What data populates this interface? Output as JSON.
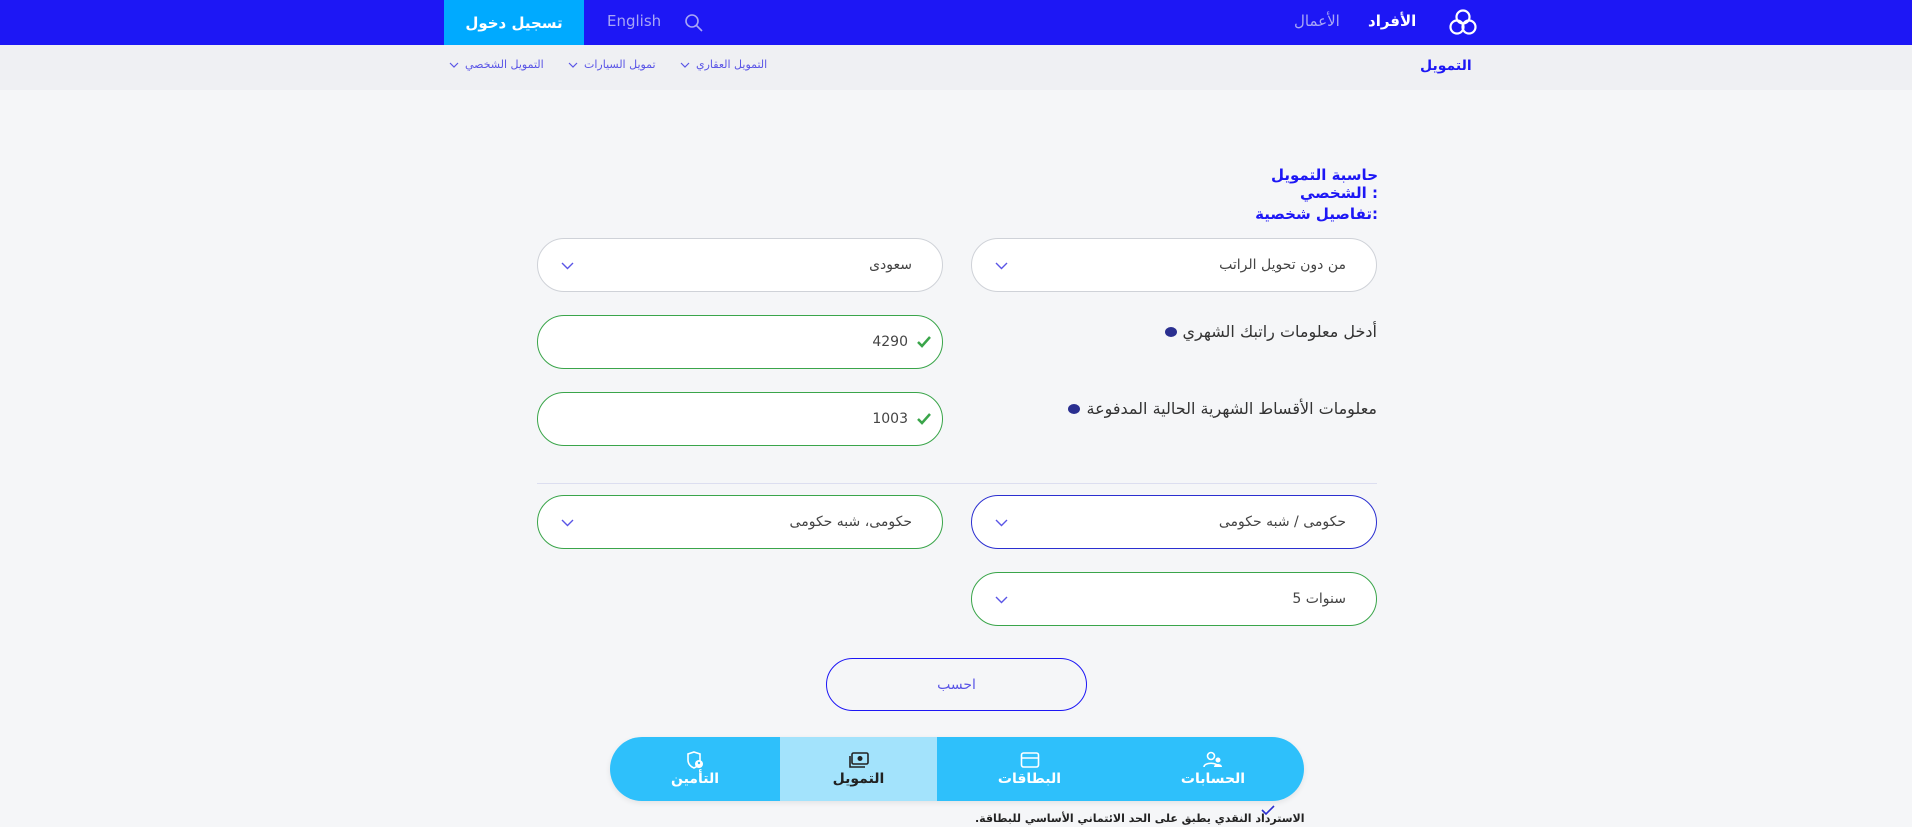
{
  "header": {
    "nav_individuals": "الأفراد",
    "nav_business": "الأعمال",
    "language": "English",
    "login": "تسجيل دخول"
  },
  "subnav": {
    "title": "التمويل",
    "items": [
      {
        "label": "التمويل العقاري"
      },
      {
        "label": "تمويل السيارات"
      },
      {
        "label": "التمويل الشخصي"
      }
    ]
  },
  "form": {
    "heading": "حاسبة التمويل الشخصي :",
    "subheading": "تفاصيل شخصية:",
    "salary_transfer": {
      "value": "من دون تحويل الراتب"
    },
    "nationality": {
      "value": "سعودى"
    },
    "salary": {
      "label": "أدخل معلومات راتبك الشهري",
      "value": "4290"
    },
    "installments": {
      "label": "معلومات الأقساط الشهرية الحالية المدفوعة",
      "value": "1003"
    },
    "employer_type": {
      "value": "حكومى / شبه حكومى"
    },
    "employer_sector": {
      "value": "حكومى، شبه حكومى"
    },
    "tenure": {
      "value": "5 سنوات"
    },
    "calculate": "احسب"
  },
  "peek": {
    "note": "الاسترداد النقدي يطبق على الحد الائتماني الأساسي للبطاقة."
  },
  "bottom_nav": {
    "items": [
      {
        "label": "الحسابات",
        "icon": "users-icon"
      },
      {
        "label": "البطاقات",
        "icon": "card-icon"
      },
      {
        "label": "التمويل",
        "icon": "cash-icon",
        "active": true
      },
      {
        "label": "التأمين",
        "icon": "shield-user-icon"
      }
    ]
  },
  "colors": {
    "primary": "#1d17f5",
    "accent": "#00aaff",
    "success": "#3aa54a",
    "bottom_nav": "#2ec0fb"
  }
}
